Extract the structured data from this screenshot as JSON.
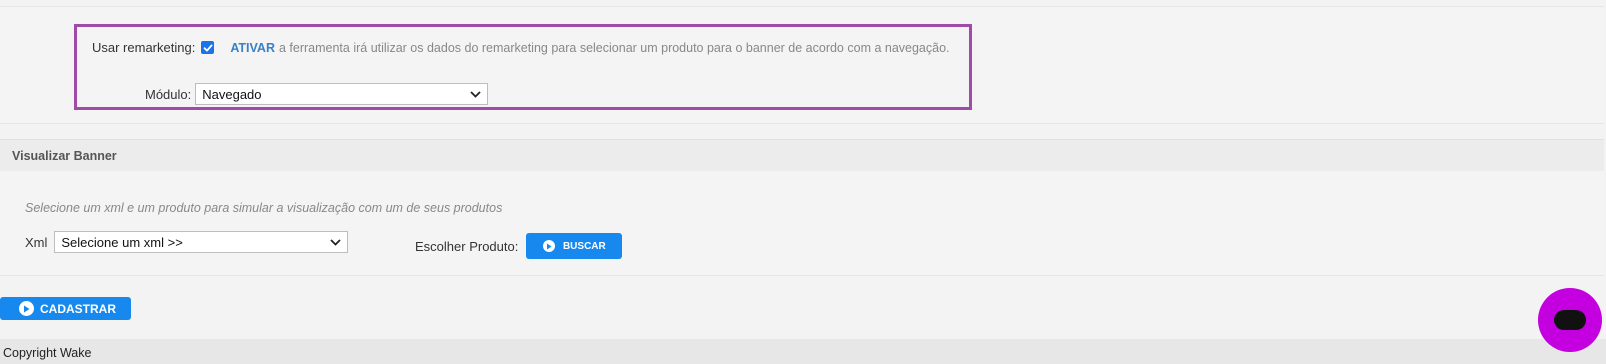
{
  "remarketing": {
    "label": "Usar remarketing:",
    "checked": true,
    "action": "ATIVAR",
    "description": "a ferramenta irá utilizar os dados do remarketing para selecionar um produto para o banner de acordo com a navegação.",
    "module_label": "Módulo:",
    "module_value": "Navegado"
  },
  "preview": {
    "title": "Visualizar Banner",
    "hint": "Selecione um xml e um produto para simular a visualização com um de seus produtos",
    "xml_label": "Xml",
    "xml_value": "Selecione um xml >>",
    "product_label": "Escolher Produto:",
    "search_button": "BUSCAR"
  },
  "actions": {
    "submit_button": "CADASTRAR"
  },
  "footer": {
    "copyright": "Copyright Wake"
  },
  "colors": {
    "accent": "#1788ee",
    "highlight": "#a04aaa",
    "chat": "#c400e0"
  },
  "icons": {
    "play": "play-circle-icon",
    "check": "check-icon",
    "chevron": "chevron-down-icon",
    "chat": "chat-icon"
  }
}
